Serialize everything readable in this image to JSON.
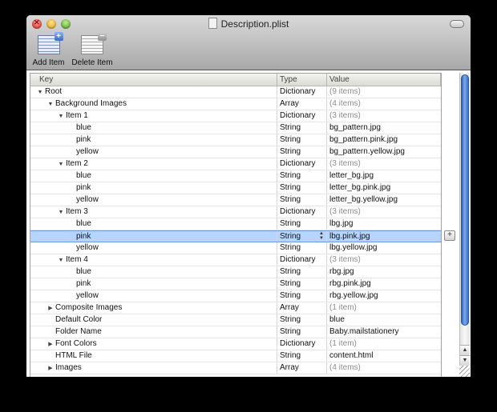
{
  "window": {
    "title": "Description.plist"
  },
  "toolbar": {
    "add_label": "Add Item",
    "delete_label": "Delete Item"
  },
  "table": {
    "columns": [
      "Key",
      "Type",
      "Value"
    ],
    "rows": [
      {
        "key": "Root",
        "type": "Dictionary",
        "value": "(9 items)",
        "level": 0,
        "disclosure": "open",
        "dim": true
      },
      {
        "key": "Background Images",
        "type": "Array",
        "value": "(4 items)",
        "level": 1,
        "disclosure": "open",
        "dim": true
      },
      {
        "key": "Item 1",
        "type": "Dictionary",
        "value": "(3 items)",
        "level": 2,
        "disclosure": "open",
        "dim": true
      },
      {
        "key": "blue",
        "type": "String",
        "value": "bg_pattern.jpg",
        "level": 3,
        "disclosure": "none",
        "dim": false
      },
      {
        "key": "pink",
        "type": "String",
        "value": "bg_pattern.pink.jpg",
        "level": 3,
        "disclosure": "none",
        "dim": false
      },
      {
        "key": "yellow",
        "type": "String",
        "value": "bg_pattern.yellow.jpg",
        "level": 3,
        "disclosure": "none",
        "dim": false
      },
      {
        "key": "Item 2",
        "type": "Dictionary",
        "value": "(3 items)",
        "level": 2,
        "disclosure": "open",
        "dim": true
      },
      {
        "key": "blue",
        "type": "String",
        "value": "letter_bg.jpg",
        "level": 3,
        "disclosure": "none",
        "dim": false
      },
      {
        "key": "pink",
        "type": "String",
        "value": "letter_bg.pink.jpg",
        "level": 3,
        "disclosure": "none",
        "dim": false
      },
      {
        "key": "yellow",
        "type": "String",
        "value": "letter_bg.yellow.jpg",
        "level": 3,
        "disclosure": "none",
        "dim": false
      },
      {
        "key": "Item 3",
        "type": "Dictionary",
        "value": "(3 items)",
        "level": 2,
        "disclosure": "open",
        "dim": true
      },
      {
        "key": "blue",
        "type": "String",
        "value": "lbg.jpg",
        "level": 3,
        "disclosure": "none",
        "dim": false
      },
      {
        "key": "pink",
        "type": "String",
        "value": "lbg.pink.jpg",
        "level": 3,
        "disclosure": "none",
        "dim": false,
        "selected": true
      },
      {
        "key": "yellow",
        "type": "String",
        "value": "lbg.yellow.jpg",
        "level": 3,
        "disclosure": "none",
        "dim": false
      },
      {
        "key": "Item 4",
        "type": "Dictionary",
        "value": "(3 items)",
        "level": 2,
        "disclosure": "open",
        "dim": true
      },
      {
        "key": "blue",
        "type": "String",
        "value": "rbg.jpg",
        "level": 3,
        "disclosure": "none",
        "dim": false
      },
      {
        "key": "pink",
        "type": "String",
        "value": "rbg.pink.jpg",
        "level": 3,
        "disclosure": "none",
        "dim": false
      },
      {
        "key": "yellow",
        "type": "String",
        "value": "rbg.yellow.jpg",
        "level": 3,
        "disclosure": "none",
        "dim": false
      },
      {
        "key": "Composite Images",
        "type": "Array",
        "value": "(1 item)",
        "level": 1,
        "disclosure": "closed",
        "dim": true
      },
      {
        "key": "Default Color",
        "type": "String",
        "value": "blue",
        "level": 1,
        "disclosure": "none",
        "dim": false
      },
      {
        "key": "Folder Name",
        "type": "String",
        "value": "Baby.mailstationery",
        "level": 1,
        "disclosure": "none",
        "dim": false
      },
      {
        "key": "Font Colors",
        "type": "Dictionary",
        "value": "(1 item)",
        "level": 1,
        "disclosure": "closed",
        "dim": true
      },
      {
        "key": "HTML File",
        "type": "String",
        "value": "content.html",
        "level": 1,
        "disclosure": "none",
        "dim": false
      },
      {
        "key": "Images",
        "type": "Array",
        "value": "(4 items)",
        "level": 1,
        "disclosure": "closed",
        "dim": true
      }
    ]
  },
  "icons": {
    "open_disclosure": "triangle-down-icon",
    "closed_disclosure": "triangle-right-icon"
  },
  "colors": {
    "selection": "#b5d5ff",
    "scroll_thumb": "#3a6fc8"
  }
}
